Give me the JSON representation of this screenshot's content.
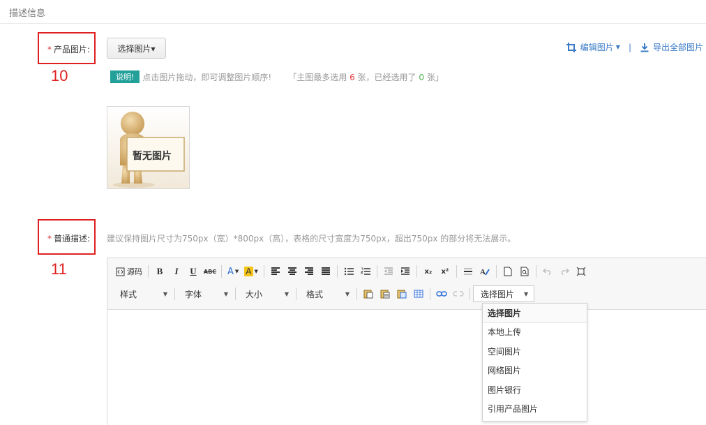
{
  "section": {
    "title": "描述信息"
  },
  "product_images": {
    "required_mark": "*",
    "label": "产品图片:",
    "select_button": "选择图片▾",
    "edit_label": "编辑图片",
    "export_label": "导出全部图片",
    "divider": "|",
    "badge": "说明!",
    "note_text": "点击图片拖动，即可调整图片顺序!",
    "limit_prefix": "「主图最多选用",
    "limit_max": "6",
    "limit_mid": "张，已经选用了",
    "limit_used": "0",
    "limit_suffix": "张」",
    "placeholder_text": "暂无图片"
  },
  "description": {
    "required_mark": "*",
    "label": "普通描述:",
    "hint": "建议保持图片尺寸为750px（宽）*800px（高），表格的尺寸宽度为750px，超出750px 的部分将无法展示。"
  },
  "annotations": {
    "first": "10",
    "second": "11"
  },
  "editor": {
    "source_label": "源码",
    "bold": "B",
    "italic": "I",
    "underline": "U",
    "strike": "ABC",
    "font_color": "A",
    "bg_color": "A",
    "sub": "x₂",
    "sup": "x²",
    "style_label": "样式",
    "font_label": "字体",
    "size_label": "大小",
    "format_label": "格式",
    "select_image_label": "选择图片"
  },
  "dropdown": {
    "header": "选择图片",
    "items": [
      "本地上传",
      "空间图片",
      "网络图片",
      "图片银行",
      "引用产品图片"
    ]
  },
  "colors": {
    "accent": "#3b7bc6",
    "required": "#e4393c",
    "badge": "#23a09a",
    "annotation": "#e02020"
  }
}
